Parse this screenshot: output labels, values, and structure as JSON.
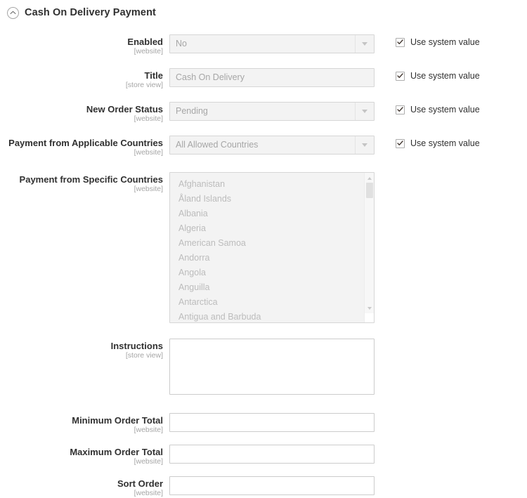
{
  "section": {
    "title": "Cash On Delivery Payment",
    "collapse_icon": "chevron-up-circle-icon",
    "expanded": true
  },
  "common": {
    "use_system_value_label": "Use system value",
    "scope_website": "[website]",
    "scope_store_view": "[store view]",
    "checked_glyph": "checkmark-icon",
    "dropdown_glyph": "chevron-down-icon"
  },
  "colors": {
    "text": "#303030",
    "muted": "#a6a6a6",
    "disabled_bg": "#f3f3f3",
    "border": "#d6d6d6",
    "enabled_border": "#cccccc",
    "page_bg": "#ffffff"
  },
  "fields": {
    "enabled": {
      "label": "Enabled",
      "scope": "[website]",
      "type": "select",
      "value": "No",
      "disabled": true,
      "use_system_value": true
    },
    "title": {
      "label": "Title",
      "scope": "[store view]",
      "type": "text",
      "value": "Cash On Delivery",
      "disabled": true,
      "use_system_value": true
    },
    "new_order_status": {
      "label": "New Order Status",
      "scope": "[website]",
      "type": "select",
      "value": "Pending",
      "disabled": true,
      "use_system_value": true
    },
    "payment_applicable_countries": {
      "label": "Payment from Applicable Countries",
      "scope": "[website]",
      "type": "select",
      "value": "All Allowed Countries",
      "disabled": true,
      "use_system_value": true
    },
    "payment_specific_countries": {
      "label": "Payment from Specific Countries",
      "scope": "[website]",
      "type": "multiselect",
      "disabled": true,
      "use_system_value": false,
      "options": [
        "Afghanistan",
        "Åland Islands",
        "Albania",
        "Algeria",
        "American Samoa",
        "Andorra",
        "Angola",
        "Anguilla",
        "Antarctica",
        "Antigua and Barbuda"
      ]
    },
    "instructions": {
      "label": "Instructions",
      "scope": "[store view]",
      "type": "textarea",
      "value": "",
      "disabled": false,
      "use_system_value": false
    },
    "minimum_order_total": {
      "label": "Minimum Order Total",
      "scope": "[website]",
      "type": "text",
      "value": "",
      "disabled": false,
      "use_system_value": false
    },
    "maximum_order_total": {
      "label": "Maximum Order Total",
      "scope": "[website]",
      "type": "text",
      "value": "",
      "disabled": false,
      "use_system_value": false
    },
    "sort_order": {
      "label": "Sort Order",
      "scope": "[website]",
      "type": "text",
      "value": "",
      "disabled": false,
      "use_system_value": false
    }
  }
}
